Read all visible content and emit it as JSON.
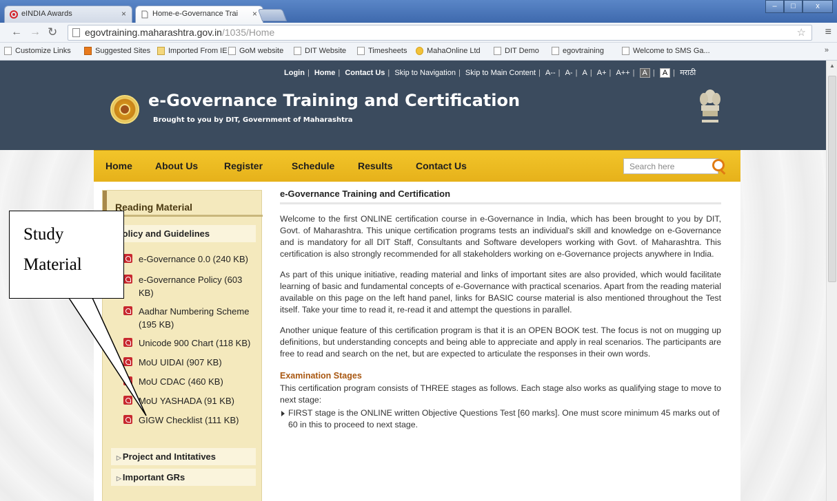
{
  "browser": {
    "tabs": [
      {
        "title": "eINDIA Awards",
        "close": "×"
      },
      {
        "title": "Home-e-Governance Trai",
        "close": "×"
      }
    ],
    "window_controls": {
      "minimize": "–",
      "maximize": "□",
      "close": "x"
    },
    "url": {
      "host": "egovtraining.maharashtra.gov.in",
      "path": "/1035/Home"
    },
    "bookmarks": [
      "Customize Links",
      "Suggested Sites",
      "Imported From IE",
      "GoM website",
      "DIT Website",
      "Timesheets",
      "MahaOnline Ltd",
      "DIT Demo",
      "egovtraining",
      "Welcome to SMS Ga..."
    ],
    "bookmarks_more": "»"
  },
  "site": {
    "toplinks": {
      "login": "Login",
      "home": "Home",
      "contact": "Contact Us",
      "skip_nav": "Skip to Navigation",
      "skip_main": "Skip to Main Content",
      "font_sizes": [
        "A--",
        "A-",
        "A",
        "A+",
        "A++"
      ],
      "contrast": [
        "A",
        "A"
      ],
      "lang": "मराठी"
    },
    "title": "e-Governance Training and Certification",
    "subtitle": "Brought to you by DIT, Government of Maharashtra",
    "nav": [
      "Home",
      "About Us",
      "Register",
      "Schedule",
      "Results",
      "Contact Us"
    ],
    "search_placeholder": "Search here"
  },
  "sidebar": {
    "heading": "Reading Material",
    "categories": {
      "policy": "Policy and Guidelines",
      "projects": "Project and Intitatives",
      "grs": "Important GRs"
    },
    "docs": [
      "e-Governance 0.0 (240 KB)",
      "e-Governance Policy (603 KB)",
      "Aadhar Numbering Scheme (195 KB)",
      "Unicode 900 Chart (118 KB)",
      "MoU UIDAI (907 KB)",
      "MoU CDAC (460 KB)",
      "MoU YASHADA (91 KB)",
      "GIGW Checklist (111 KB)"
    ]
  },
  "main": {
    "heading": "e-Governance Training and Certification",
    "para1": "Welcome to the first ONLINE certification course in e-Governance in India, which has been brought to you by DIT, Govt. of Maharashtra. This unique certification programs tests an individual's skill and knowledge on e-Governance and is mandatory for all DIT Staff, Consultants and Software developers working with Govt. of Maharashtra. This certification is also strongly recommended for all stakeholders working on e-Governance projects anywhere in India.",
    "para2": "As part of this unique initiative, reading material and links of important sites are also provided, which would facilitate learning of basic and fundamental concepts of e-Governance with practical scenarios. Apart from the reading material available on this page on the left hand panel, links for BASIC course material is also mentioned throughout the Test itself. Take your time to read it, re-read it and attempt the questions in parallel.",
    "para3": "Another unique feature of this certification program is that it is an OPEN BOOK test. The focus is not on mugging up definitions, but understanding concepts and being able to appreciate and apply in real scenarios. The participants are free to read and search on the net, but are expected to articulate the responses in their own words.",
    "stages_heading": "Examination Stages",
    "stages_intro": "This certification program consists of THREE stages as follows. Each stage also works as qualifying stage to move to next stage:",
    "stage1": "FIRST stage is the ONLINE written Objective Questions Test [60 marks]. One must score minimum 45 marks out of 60 in this to proceed to next stage."
  },
  "annotation": {
    "line1": "Study",
    "line2": "Material"
  }
}
